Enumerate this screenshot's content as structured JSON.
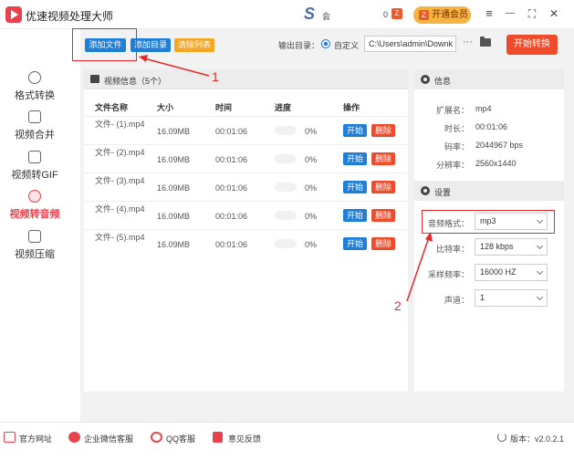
{
  "app": {
    "title": "优速视频处理大师"
  },
  "header": {
    "brand_letter": "S",
    "user": "会",
    "count": "0",
    "count_badge": "Z",
    "vip_icon": "Z",
    "vip_label": "开通会员",
    "menu": "≡",
    "minimize": "—",
    "maximize": "⛶",
    "close": "✕"
  },
  "sidebar": {
    "items": [
      {
        "label": "格式转换",
        "icon": "convert-icon"
      },
      {
        "label": "视频合并",
        "icon": "merge-icon"
      },
      {
        "label": "视频转GIF",
        "icon": "gif-icon"
      },
      {
        "label": "视频转音频",
        "icon": "audio-icon",
        "active": true
      },
      {
        "label": "视频压缩",
        "icon": "compress-icon"
      }
    ]
  },
  "toolbar": {
    "add_file": "添加文件",
    "add_dir": "添加目录",
    "clear_list": "清除列表",
    "output_label": "输出目录：",
    "custom_label": "自定义",
    "output_path": "C:\\Users\\admin\\Downk",
    "more": "···",
    "start_convert": "开始转换"
  },
  "video_list": {
    "title": "视频信息（5个）",
    "columns": [
      "文件名称",
      "大小",
      "时间",
      "进度",
      "操作"
    ],
    "rows": [
      {
        "name": "文件- (1).mp4",
        "size": "16.09MB",
        "time": "00:01:06",
        "progress": "0%",
        "progress_value": 0
      },
      {
        "name": "文件- (2).mp4",
        "size": "16.09MB",
        "time": "00:01:06",
        "progress": "0%",
        "progress_value": 0
      },
      {
        "name": "文件- (3).mp4",
        "size": "16.09MB",
        "time": "00:01:06",
        "progress": "0%",
        "progress_value": 0
      },
      {
        "name": "文件- (4).mp4",
        "size": "16.09MB",
        "time": "00:01:06",
        "progress": "0%",
        "progress_value": 0
      },
      {
        "name": "文件- (5).mp4",
        "size": "16.09MB",
        "time": "00:01:06",
        "progress": "0%",
        "progress_value": 0
      }
    ],
    "start_label": "开始",
    "delete_label": "删除"
  },
  "info": {
    "title": "信息",
    "ext_key": "扩展名：",
    "ext_val": "mp4",
    "dur_key": "时长：",
    "dur_val": "00:01:06",
    "bitrate_key": "码率：",
    "bitrate_val": "2044967 bps",
    "res_key": "分辨率：",
    "res_val": "2560x1440"
  },
  "settings": {
    "title": "设置",
    "format_key": "音频格式：",
    "format_val": "mp3",
    "bitrate_key": "比特率：",
    "bitrate_val": "128 kbps",
    "sample_key": "采样频率：",
    "sample_val": "16000 HZ",
    "channel_key": "声道：",
    "channel_val": "1"
  },
  "annotations": {
    "one": "1",
    "two": "2"
  },
  "footer": {
    "website": "官方网址",
    "wechat": "企业微信客服",
    "qq": "QQ客服",
    "feedback": "意见反馈",
    "version": "版本：v2.0.2.1"
  },
  "colors": {
    "accent": "#e8424f",
    "primary_blue": "#1e7fd9",
    "danger": "#ef4a2a",
    "vip": "#f7b342"
  }
}
